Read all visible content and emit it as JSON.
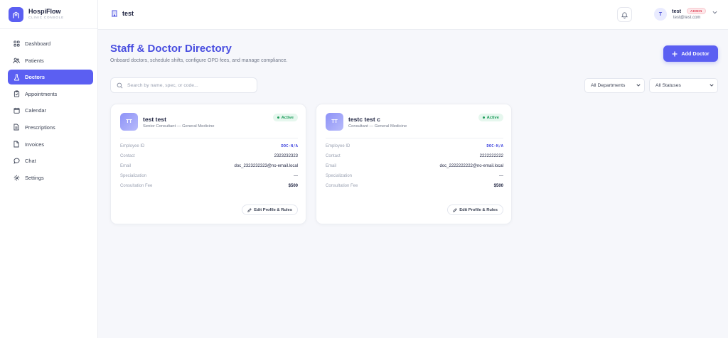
{
  "brand": {
    "name": "HospiFlow",
    "subtitle": "CLINIC CONSOLE"
  },
  "sidebar": {
    "items": [
      {
        "label": "Dashboard",
        "icon": "grid-icon",
        "active": false
      },
      {
        "label": "Patients",
        "icon": "users-icon",
        "active": false
      },
      {
        "label": "Doctors",
        "icon": "flask-icon",
        "active": true
      },
      {
        "label": "Appointments",
        "icon": "clipboard-check-icon",
        "active": false
      },
      {
        "label": "Calendar",
        "icon": "calendar-icon",
        "active": false
      },
      {
        "label": "Prescriptions",
        "icon": "file-text-icon",
        "active": false
      },
      {
        "label": "Invoices",
        "icon": "file-icon",
        "active": false
      },
      {
        "label": "Chat",
        "icon": "chat-bubble-icon",
        "active": false
      },
      {
        "label": "Settings",
        "icon": "gear-icon",
        "active": false
      }
    ]
  },
  "header": {
    "clinic_name": "test",
    "user": {
      "initial": "T",
      "name": "test",
      "role": "ADMIN",
      "email": "test@test.com"
    }
  },
  "main": {
    "title": "Staff & Doctor Directory",
    "subtitle": "Onboard doctors, schedule shifts, configure OPD fees, and manage compliance.",
    "add_button": "Add Doctor",
    "search": {
      "placeholder": "Search by name, spec, or code...",
      "value": ""
    },
    "filters": {
      "department": "All Departments",
      "status": "All Statuses"
    }
  },
  "field_labels": {
    "employee_id": "Employee ID",
    "contact": "Contact",
    "email": "Email",
    "specialization": "Specialization",
    "fee": "Consultation Fee"
  },
  "doctors": [
    {
      "initials": "TT",
      "name": "test test",
      "role": "Senior Consultant — General Medicine",
      "status": "Active",
      "employee_id": "DOC-N/A",
      "contact": "2323232323",
      "email": "doc_2323232323@no-email.local",
      "specialization": "—",
      "fee": "$500",
      "edit_label": "Edit Profile & Rules"
    },
    {
      "initials": "TT",
      "name": "testc test c",
      "role": "Consultant — General Medicine",
      "status": "Active",
      "employee_id": "DOC-N/A",
      "contact": "2222222222",
      "email": "doc_2222222222@no-email.local",
      "specialization": "—",
      "fee": "$500",
      "edit_label": "Edit Profile & Rules"
    }
  ],
  "colors": {
    "accent": "#5b5ff2",
    "title": "#4a4fe0",
    "active_status": "#1f9d5c",
    "admin_badge": "#e2465b"
  }
}
